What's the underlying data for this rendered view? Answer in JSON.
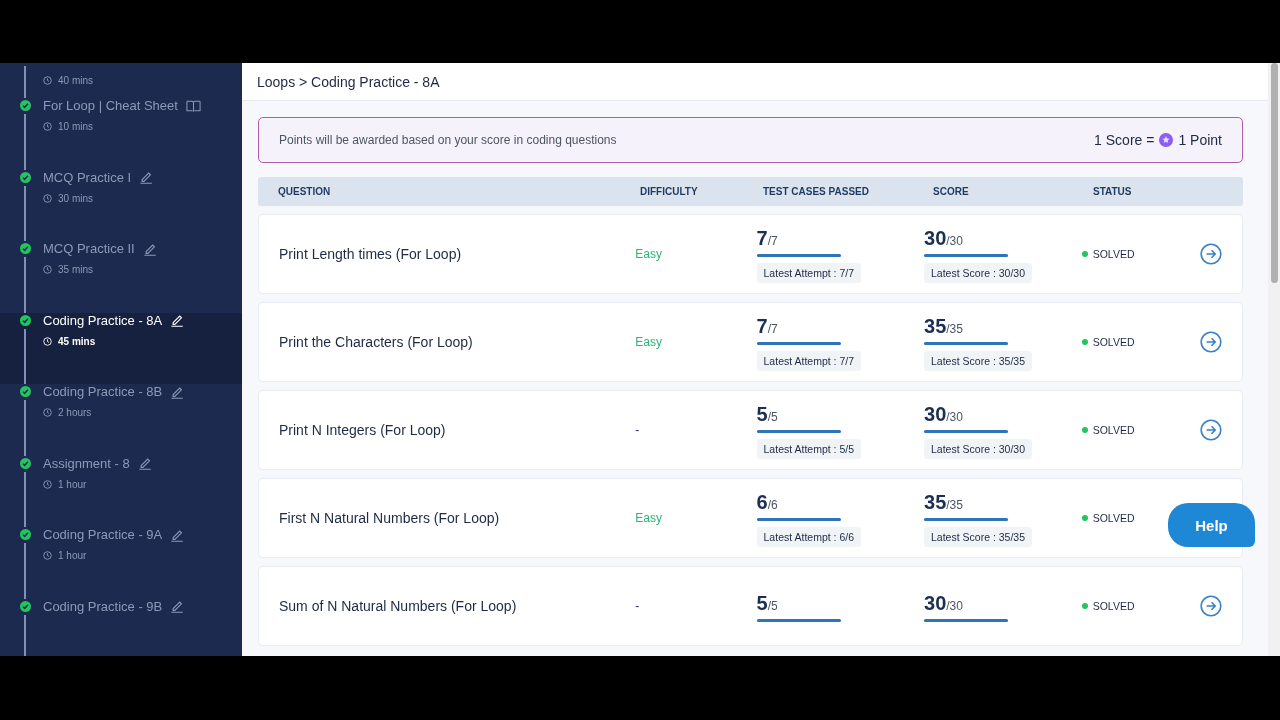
{
  "sidebar": {
    "items": [
      {
        "duration": "40 mins",
        "selected": false
      },
      {
        "title": "For Loop | Cheat Sheet",
        "duration": "10 mins",
        "kind": "cheatsheet",
        "completed": true,
        "selected": false
      },
      {
        "title": "MCQ Practice I",
        "duration": "30 mins",
        "kind": "practice",
        "completed": true,
        "selected": false
      },
      {
        "title": "MCQ Practice II",
        "duration": "35 mins",
        "kind": "practice",
        "completed": true,
        "selected": false
      },
      {
        "title": "Coding Practice - 8A",
        "duration": "45 mins",
        "kind": "practice",
        "completed": true,
        "selected": true
      },
      {
        "title": "Coding Practice - 8B",
        "duration": "2 hours",
        "kind": "practice",
        "completed": true,
        "selected": false
      },
      {
        "title": "Assignment - 8",
        "duration": "1 hour",
        "kind": "practice",
        "completed": true,
        "selected": false
      },
      {
        "title": "Coding Practice - 9A",
        "duration": "1 hour",
        "kind": "practice",
        "completed": true,
        "selected": false
      },
      {
        "title": "Coding Practice - 9B",
        "kind": "practice",
        "completed": true,
        "selected": false
      }
    ]
  },
  "breadcrumb": "Loops > Coding Practice - 8A",
  "notice": {
    "text": "Points will be awarded based on your score in coding questions",
    "score_label": "1 Score =",
    "point_label": "1 Point"
  },
  "table": {
    "columns": [
      "QUESTION",
      "DIFFICULTY",
      "TEST CASES PASSED",
      "SCORE",
      "STATUS"
    ],
    "rows": [
      {
        "question": "Print Length times (For Loop)",
        "difficulty": {
          "text": "Easy",
          "kind": "easy"
        },
        "passed": "7",
        "total": "/7",
        "passed_bar": {
          "level": 1
        },
        "attempt": "Latest Attempt : 7/7",
        "score": "30",
        "score_total": "/30",
        "score_bar": {
          "level": 1
        },
        "latest_score": "Latest Score : 30/30",
        "status": "SOLVED",
        "solved": true
      },
      {
        "question": "Print the Characters (For Loop)",
        "difficulty": {
          "text": "Easy",
          "kind": "easy"
        },
        "passed": "7",
        "total": "/7",
        "passed_bar": {
          "level": 1
        },
        "attempt": "Latest Attempt : 7/7",
        "score": "35",
        "score_total": "/35",
        "score_bar": {
          "level": 1
        },
        "latest_score": "Latest Score : 35/35",
        "status": "SOLVED",
        "solved": true
      },
      {
        "question": "Print N Integers (For Loop)",
        "difficulty": {
          "text": "-",
          "kind": "none"
        },
        "passed": "5",
        "total": "/5",
        "passed_bar": {
          "level": 1
        },
        "attempt": "Latest Attempt : 5/5",
        "score": "30",
        "score_total": "/30",
        "score_bar": {
          "level": 1
        },
        "latest_score": "Latest Score : 30/30",
        "status": "SOLVED",
        "solved": true
      },
      {
        "question": "First N Natural Numbers (For Loop)",
        "difficulty": {
          "text": "Easy",
          "kind": "easy"
        },
        "passed": "6",
        "total": "/6",
        "passed_bar": {
          "level": 1
        },
        "attempt": "Latest Attempt : 6/6",
        "score": "35",
        "score_total": "/35",
        "score_bar": {
          "level": 1
        },
        "latest_score": "Latest Score : 35/35",
        "status": "SOLVED",
        "solved": true
      },
      {
        "question": "Sum of N Natural Numbers (For Loop)",
        "difficulty": {
          "text": "-",
          "kind": "none"
        },
        "passed": "5",
        "total": "/5",
        "passed_bar": {
          "level": 1
        },
        "score": "30",
        "score_total": "/30",
        "score_bar": {
          "level": 1
        },
        "status": "SOLVED",
        "solved": true
      }
    ]
  },
  "help_button": "Help"
}
